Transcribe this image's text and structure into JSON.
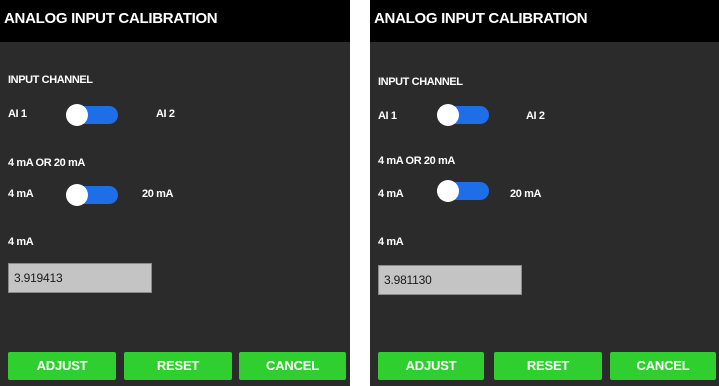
{
  "panels": [
    {
      "title": "ANALOG INPUT CALIBRATION",
      "input_channel_label": "INPUT CHANNEL",
      "channel_left": "AI 1",
      "channel_right": "AI 2",
      "range_label": "4 mA OR 20 mA",
      "range_left": "4 mA",
      "range_right": "20 mA",
      "value_label": "4 mA",
      "value": "3.919413",
      "buttons": {
        "adjust": "ADJUST",
        "reset": "RESET",
        "cancel": "CANCEL"
      }
    },
    {
      "title": "ANALOG INPUT CALIBRATION",
      "input_channel_label": "INPUT CHANNEL",
      "channel_left": "AI 1",
      "channel_right": "AI 2",
      "range_label": "4 mA OR 20 mA",
      "range_left": "4 mA",
      "range_right": "20 mA",
      "value_label": "4 mA",
      "value": "3.981130",
      "buttons": {
        "adjust": "ADJUST",
        "reset": "RESET",
        "cancel": "CANCEL"
      }
    }
  ],
  "colors": {
    "background": "#2b2b2b",
    "header": "#000000",
    "toggle_track": "#1e6ee8",
    "button": "#2fcf2f",
    "field": "#c4c4c4"
  }
}
